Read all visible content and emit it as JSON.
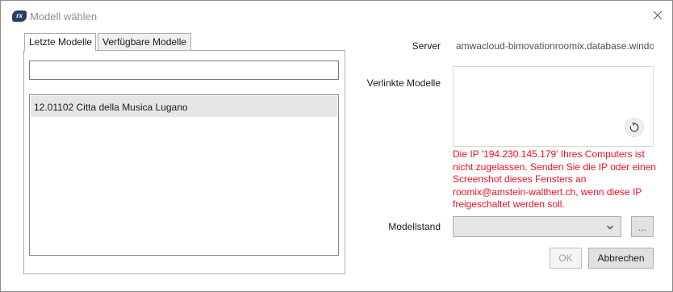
{
  "window": {
    "title": "Modell wählen",
    "app_icon_text": "rx"
  },
  "tabs": [
    {
      "label": "Letzte Modelle",
      "active": true
    },
    {
      "label": "Verfügbare Modelle",
      "active": false
    }
  ],
  "filter": {
    "value": "",
    "placeholder": ""
  },
  "models": [
    {
      "name": "12.01102 Citta della Musica Lugano",
      "selected": true
    }
  ],
  "server": {
    "label": "Server",
    "value": "amwacloud-bimovationroomix.database.windows.net"
  },
  "linked_models": {
    "label": "Verlinkte Modelle"
  },
  "error": {
    "message": "Die IP '194.230.145.179' Ihres Computers ist nicht zugelassen. Senden Sie die IP oder einen Screenshot dieses Fensters an roomix@amstein-walthert.ch, wenn diese IP freigeschaltet werden soll.",
    "color": "#e81123"
  },
  "model_state": {
    "label": "Modellstand",
    "value": "",
    "browse_label": "..."
  },
  "buttons": {
    "ok": "OK",
    "cancel": "Abbrechen"
  },
  "icons": {
    "app": "roomix-logo-icon",
    "close": "close-icon",
    "refresh": "refresh-icon",
    "dropdown": "chevron-down-icon"
  }
}
